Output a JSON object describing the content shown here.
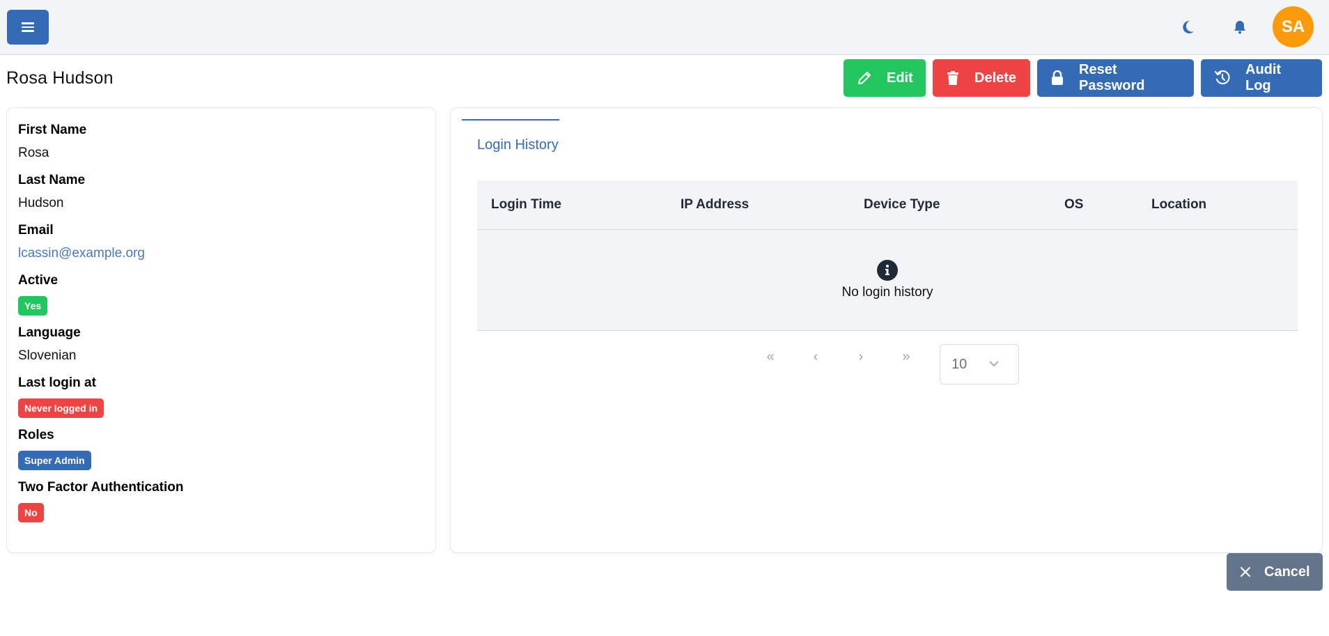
{
  "topbar": {
    "menu_icon": "hamburger-menu-icon",
    "theme_icon": "moon-icon",
    "notifications_icon": "bell-icon",
    "avatar_initials": "SA",
    "avatar_color": "#fb9a0a"
  },
  "page": {
    "title": "Rosa Hudson"
  },
  "actions": {
    "edit": {
      "label": "Edit",
      "icon": "pencil-icon",
      "color": "#22c55e"
    },
    "delete": {
      "label": "Delete",
      "icon": "trash-icon",
      "color": "#ef4444"
    },
    "reset_password": {
      "label": "Reset Password",
      "icon": "lock-icon",
      "color": "#356bb5"
    },
    "audit_log": {
      "label": "Audit Log",
      "icon": "history-icon",
      "color": "#356bb5"
    }
  },
  "details": {
    "first_name": {
      "label": "First Name",
      "value": "Rosa"
    },
    "last_name": {
      "label": "Last Name",
      "value": "Hudson"
    },
    "email": {
      "label": "Email",
      "value": "lcassin@example.org"
    },
    "active": {
      "label": "Active",
      "value": "Yes",
      "status_color": "#22c55e"
    },
    "language": {
      "label": "Language",
      "value": "Slovenian"
    },
    "last_login": {
      "label": "Last login at",
      "value": "Never logged in",
      "status_color": "#ef4444"
    },
    "roles": {
      "label": "Roles",
      "values": [
        "Super Admin"
      ],
      "status_color": "#356bb5"
    },
    "two_factor": {
      "label": "Two Factor Authentication",
      "value": "No",
      "status_color": "#ef4444"
    }
  },
  "login_history": {
    "tab_label": "Login History",
    "columns": [
      "Login Time",
      "IP Address",
      "Device Type",
      "OS",
      "Location"
    ],
    "rows": [],
    "empty_icon": "info-circle-icon",
    "empty_text": "No login history",
    "pagination": {
      "first": "«",
      "prev": "‹",
      "next": "›",
      "last": "»",
      "per_page": "10"
    }
  },
  "footer": {
    "cancel_label": "Cancel",
    "cancel_icon": "close-icon"
  }
}
